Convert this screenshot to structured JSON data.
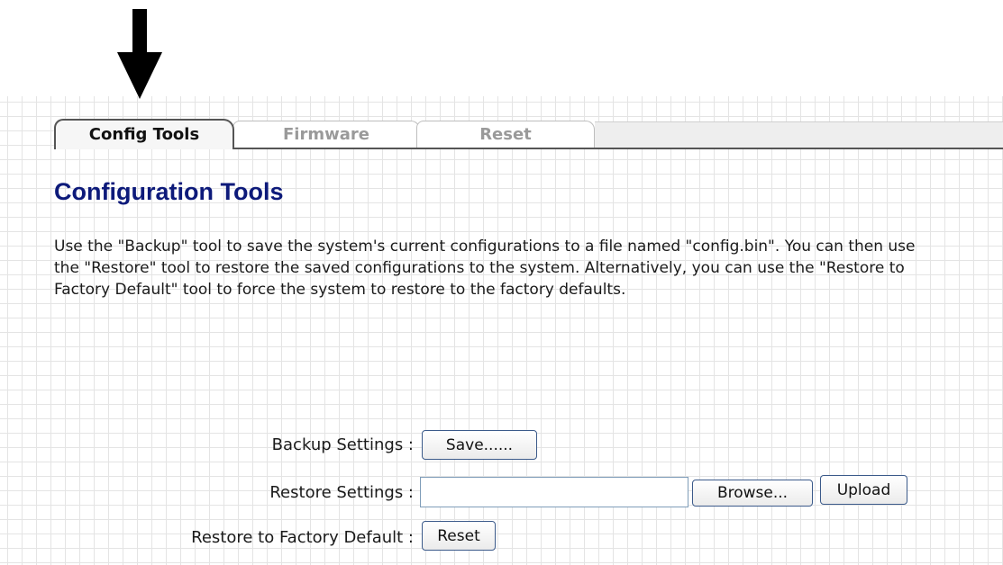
{
  "tabs": {
    "config_tools": "Config Tools",
    "firmware": "Firmware",
    "reset": "Reset",
    "active": "config_tools"
  },
  "page": {
    "title": "Configuration Tools",
    "description": "Use the \"Backup\" tool to save the system's current configurations to a file named \"config.bin\". You can then use the \"Restore\" tool to restore the saved configurations to the system. Alternatively, you can use the \"Restore to Factory Default\" tool to force the system to restore to the factory defaults."
  },
  "backup": {
    "label": "Backup Settings :",
    "save_button": "Save......"
  },
  "restore": {
    "label": "Restore Settings :",
    "file_value": "",
    "browse_button": "Browse...",
    "upload_button": "Upload"
  },
  "factory": {
    "label": "Restore to Factory Default :",
    "reset_button": "Reset"
  },
  "icons": {
    "pointer": "down-arrow-icon"
  },
  "colors": {
    "title": "#0d1a7a",
    "grid_line": "#e4e4e4",
    "button_border": "#3b5a8a",
    "input_border": "#7f9db9",
    "inactive_tab_text": "#9a9a9a"
  }
}
